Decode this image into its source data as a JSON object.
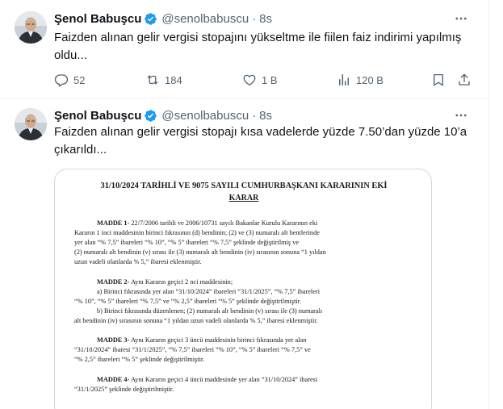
{
  "tweets": [
    {
      "author": "Şenol Babuşcu",
      "handle": "@senolbabuscu",
      "separator": "·",
      "time": "8s",
      "text_line1": "Faizden alınan gelir vergisi stopajını yükseltme ile fiilen faiz indirimi yapılmış",
      "text_line2": "oldu...",
      "stats": {
        "replies": "52",
        "retweets": "184",
        "likes": "1 B",
        "views": "120 B"
      }
    },
    {
      "author": "Şenol Babuşcu",
      "handle": "@senolbabuscu",
      "separator": "·",
      "time": "8s",
      "text_line1": "Faizden alınan gelir vergisi  stopajı kısa vadelerde yüzde 7.50’dan yüzde 10’a",
      "text_line2": "çıkarıldı..."
    }
  ],
  "document": {
    "title": "31/10/2024 TARİHLİ VE 9075 SAYILI CUMHURBAŞKANI KARARININ EKİ",
    "subtitle": "KARAR",
    "lines": [
      {
        "bold_prefix": "MADDE 1-",
        "text": " 22/7/2006 tarihli ve 2006/10731 sayılı Bakanlar Kurulu Kararının eki"
      },
      {
        "text": "Kararın 1 inci maddesinin birinci fıkrasının (d) bendinin; (2) ve (3) numaralı alt bentlerinde"
      },
      {
        "text": "yer alan “% 7,5” ibareleri “% 10”, “% 5” ibareleri “% 7,5” şeklinde değiştirilmiş ve"
      },
      {
        "text": "(2) numaralı alt bendinin (v) sırası ile (3) numaralı alt bendinin (iv) sırasının sonuna “1 yıldan"
      },
      {
        "text": "uzun vadeli olanlarda % 5,” ibaresi eklenmiştir."
      },
      {
        "bold_prefix": "MADDE 2-",
        "text": " Aynı Kararın geçici 2 nci maddesinin;"
      },
      {
        "text": "a) Birinci fıkrasında yer alan “31/10/2024” ibareleri “31/1/2025”, “% 7,5” ibareleri"
      },
      {
        "text": "“% 10”, “% 5” ibareleri “% 7,5” ve “% 2,5” ibareleri “% 5” şeklinde değiştirilmiştir."
      },
      {
        "text": "b) Birinci fıkrasında düzenlenen; (2) numaralı alt bendinin (v) sırası ile (3) numaralı"
      },
      {
        "text": "alt bendinin (iv) sırasının sonuna “1 yıldan uzun vadeli olanlarda % 5,” ibaresi eklenmiştir."
      },
      {
        "bold_prefix": "MADDE 3-",
        "text": " Aynı Kararın geçici 3 üncü maddesinin birinci fıkrasında yer alan"
      },
      {
        "text": "“31/10/2024” ibaresi “31/1/2025”, “% 7,5” ibareleri “% 10”, “% 5” ibareleri “% 7,5” ve"
      },
      {
        "text": "“% 2,5” ibareleri “% 5” şeklinde değiştirilmiştir."
      },
      {
        "bold_prefix": "MADDE 4-",
        "text": " Aynı Kararın geçici 4 üncü maddesinde yer alan “31/10/2024” ibaresi"
      },
      {
        "text": "“31/1/2025” şeklinde değiştirilmiştir."
      }
    ]
  },
  "colors": {
    "text": "#0f1419",
    "secondary": "#536471",
    "verified": "#1d9bf0",
    "border": "#eff3f4"
  },
  "icons": [
    "verified-badge-icon",
    "more-icon",
    "reply-icon",
    "retweet-icon",
    "like-icon",
    "views-icon",
    "bookmark-icon",
    "share-icon"
  ]
}
